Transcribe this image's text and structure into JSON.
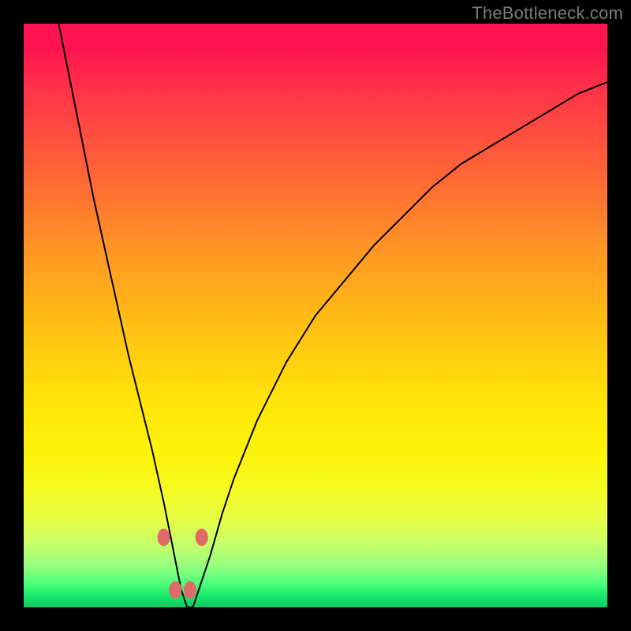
{
  "watermark": "TheBottleneck.com",
  "chart_data": {
    "type": "line",
    "title": "",
    "xlabel": "",
    "ylabel": "",
    "xlim": [
      0,
      100
    ],
    "ylim": [
      0,
      100
    ],
    "grid": false,
    "legend": false,
    "series": [
      {
        "name": "curve",
        "x": [
          6,
          8,
          10,
          12,
          14,
          16,
          18,
          20,
          22,
          24,
          25,
          26,
          27,
          28,
          29,
          30,
          32,
          34,
          36,
          40,
          45,
          50,
          55,
          60,
          65,
          70,
          75,
          80,
          85,
          90,
          95,
          100
        ],
        "y": [
          100,
          90,
          80,
          70,
          61,
          52,
          43,
          35,
          27,
          18,
          13,
          8,
          3,
          0,
          0,
          3,
          9,
          16,
          22,
          32,
          42,
          50,
          56,
          62,
          67,
          72,
          76,
          79,
          82,
          85,
          88,
          90
        ]
      }
    ],
    "markers": [
      {
        "x": 24.0,
        "y": 12.0
      },
      {
        "x": 26.0,
        "y": 3.0
      },
      {
        "x": 28.5,
        "y": 3.0
      },
      {
        "x": 30.5,
        "y": 12.0
      }
    ],
    "gradient_stops": [
      {
        "pos": 0.0,
        "color": "#ff1350"
      },
      {
        "pos": 0.27,
        "color": "#ff6a34"
      },
      {
        "pos": 0.53,
        "color": "#ffc312"
      },
      {
        "pos": 0.74,
        "color": "#fcf40a"
      },
      {
        "pos": 0.93,
        "color": "#94ff80"
      },
      {
        "pos": 1.0,
        "color": "#0fc962"
      }
    ]
  }
}
